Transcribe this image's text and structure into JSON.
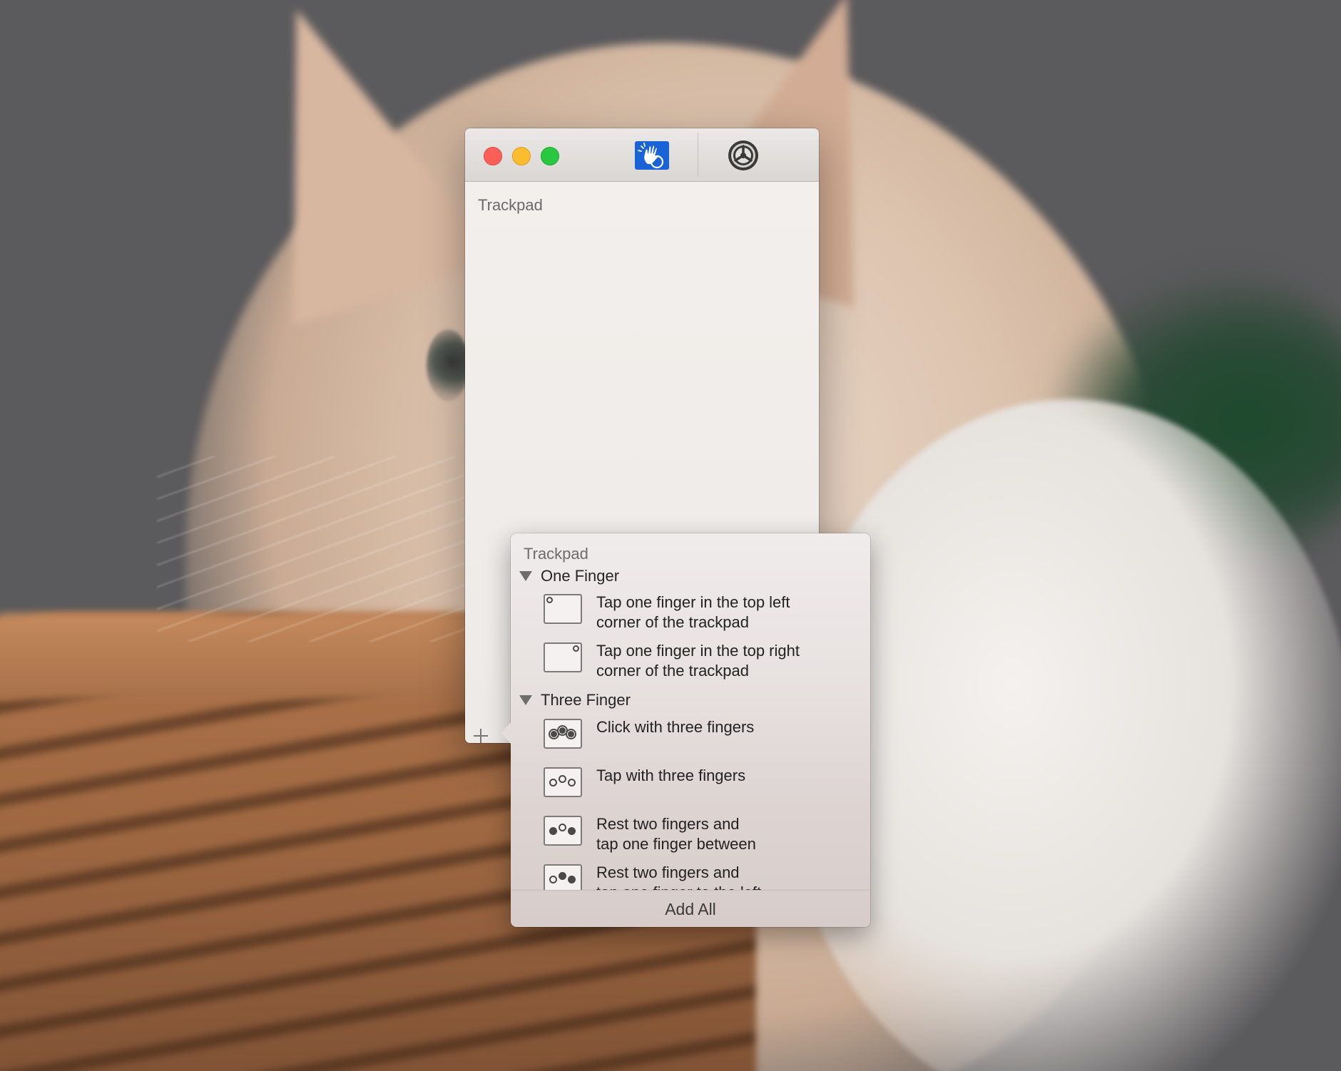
{
  "window": {
    "toolbar": [
      {
        "icon": "hand-gesture-icon",
        "active": true
      },
      {
        "icon": "gear-icon",
        "active": false
      }
    ],
    "section_title": "Trackpad",
    "accent_color": "#1963d6"
  },
  "popover": {
    "header": "Trackpad",
    "groups": [
      {
        "title": "One Finger",
        "items": [
          {
            "label": "Tap one finger in the top left\ncorner of the trackpad",
            "icon": "trackpad-top-left-icon"
          },
          {
            "label": "Tap one finger in the top right\ncorner of the trackpad",
            "icon": "trackpad-top-right-icon"
          }
        ]
      },
      {
        "title": "Three Finger",
        "items": [
          {
            "label": "Click with three fingers",
            "icon": "three-finger-click-icon"
          },
          {
            "label": "Tap with three fingers",
            "icon": "three-finger-tap-icon"
          },
          {
            "label": "Rest two fingers and\ntap one finger between",
            "icon": "rest-two-tap-between-icon"
          },
          {
            "label": "Rest two fingers and\ntap one finger to the left",
            "icon": "rest-two-tap-left-icon"
          }
        ]
      }
    ],
    "footer_button": "Add All"
  }
}
